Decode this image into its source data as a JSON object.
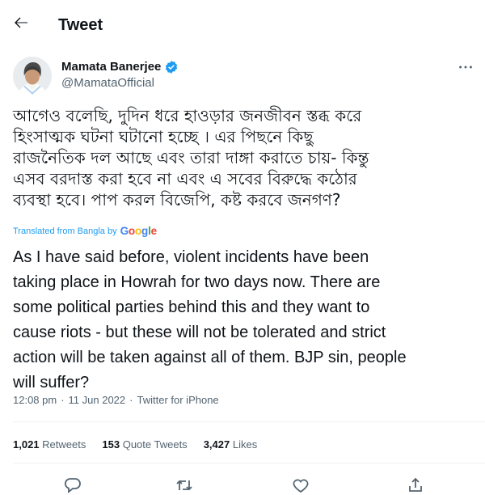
{
  "header": {
    "title": "Tweet"
  },
  "author": {
    "name": "Mamata Banerjee",
    "handle": "@MamataOfficial"
  },
  "tweet": {
    "bangla_lines": [
      "আগেও বলেছি, দুদিন ধরে হাওড়ার জনজীবন  স্তব্ধ করে",
      "হিংসাত্মক ঘটনা ঘটানো হচ্ছে । এর পিছনে কিছু",
      "রাজনৈতিক দল আছে এবং তারা দাঙ্গা করাতে চায়- কিন্তু",
      "এসব বরদাস্ত করা হবে না এবং  এ সবের বিরুদ্ধে কঠোর",
      "ব্যবস্থা হবে। পাপ করল বিজেপি,  কষ্ট করবে জনগণ?"
    ],
    "translated_label": "Translated from Bangla by",
    "translator": "Google",
    "english_lines": [
      "As I have said before, violent incidents have been",
      "taking place in Howrah for two days now. There are",
      "some political parties behind this and they want to",
      "cause riots - but these will not be tolerated and strict",
      "action will be taken against all of them. BJP sin, people",
      "will suffer?"
    ]
  },
  "meta": {
    "time": "12:08 pm",
    "separator": "·",
    "date": "11 Jun 2022",
    "source": "Twitter for iPhone"
  },
  "stats": {
    "retweets_count": "1,021",
    "retweets_label": "Retweets",
    "quotes_count": "153",
    "quotes_label": "Quote Tweets",
    "likes_count": "3,427",
    "likes_label": "Likes"
  },
  "icons": {
    "back": "arrow-left-icon",
    "verified": "verified-badge-icon",
    "more": "more-horizontal-icon",
    "reply": "reply-icon",
    "retweet": "retweet-icon",
    "like": "heart-icon",
    "share": "share-icon"
  },
  "colors": {
    "accent": "#1d9bf0",
    "text": "#0f1419",
    "secondary": "#536471",
    "divider": "#eff3f4"
  }
}
